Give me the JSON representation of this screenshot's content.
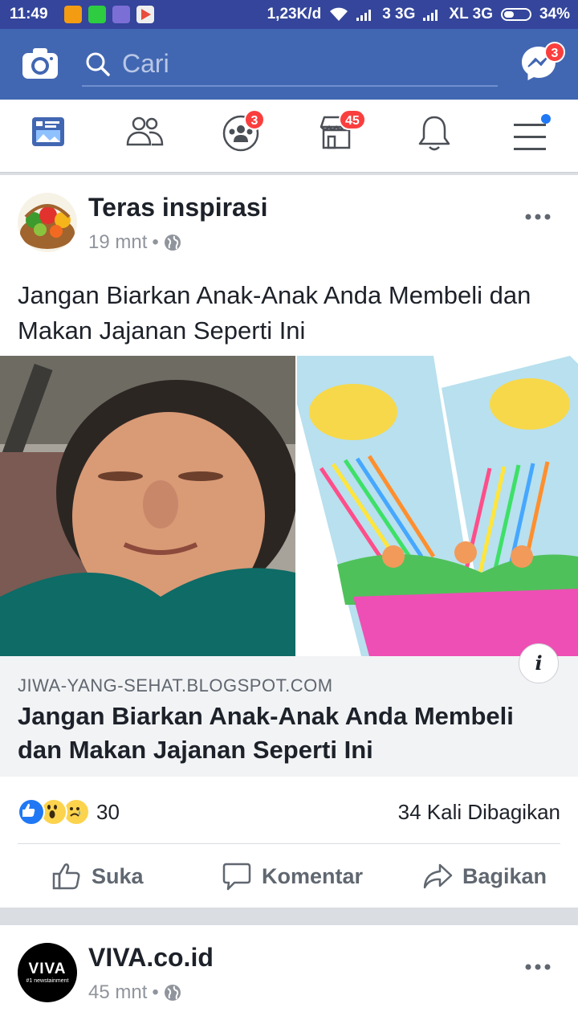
{
  "status_bar": {
    "time": "11:49",
    "speed": "1,23K/d",
    "network1": "3 3G",
    "network2": "XL 3G",
    "battery": "34%"
  },
  "top_bar": {
    "search_placeholder": "Cari",
    "messenger_badge": "3"
  },
  "nav": {
    "groups_badge": "3",
    "marketplace_badge": "45"
  },
  "post1": {
    "author": "Teras inspirasi",
    "time": "19 mnt",
    "separator": "•",
    "text": "Jangan Biarkan Anak-Anak Anda Membeli dan Makan Jajanan Seperti Ini",
    "link_domain": "JIWA-YANG-SEHAT.BLOGSPOT.COM",
    "link_title": "Jangan Biarkan Anak-Anak Anda Membeli dan Makan Jajanan Seperti Ini",
    "info_label": "i",
    "reaction_count": "30",
    "shares": "34 Kali Dibagikan",
    "actions": {
      "like": "Suka",
      "comment": "Komentar",
      "share": "Bagikan"
    }
  },
  "post2": {
    "author": "VIVA.co.id",
    "time": "45 mnt",
    "separator": "•",
    "logo_text": "VIVA",
    "logo_tagline": "#1 newstainment"
  },
  "colors": {
    "brand_blue": "#4267b2",
    "status_bar": "#34459b",
    "badge_red": "#fa3e3e",
    "like_blue": "#2078f4"
  }
}
